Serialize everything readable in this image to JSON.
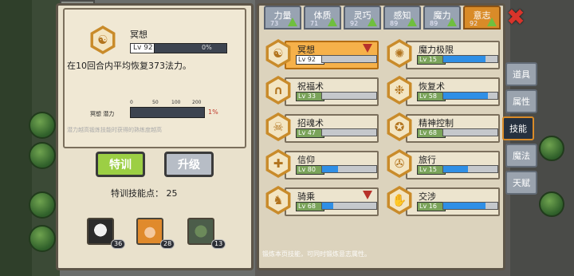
{
  "skill_detail": {
    "name": "冥想",
    "level": "Lv 92",
    "progress_text": "0%",
    "progress": 0,
    "description": "在10回合内平均恢复373法力。",
    "potential_label": "冥想 潜力",
    "potential_ticks": [
      "0",
      "50",
      "100",
      "200"
    ],
    "potential_percent": "1%",
    "note": "潜力越高锻炼技能时获得的熟练度越高"
  },
  "buttons": {
    "train": "特训",
    "upgrade": "升级"
  },
  "training_points": "特训技能点： 25",
  "companions": [
    {
      "icon": "panda-avatar",
      "count": "36"
    },
    {
      "icon": "girl-avatar",
      "count": "28"
    },
    {
      "icon": "orc-avatar",
      "count": "13"
    }
  ],
  "attributes": [
    {
      "name": "力量",
      "value": "73"
    },
    {
      "name": "体质",
      "value": "71"
    },
    {
      "name": "灵巧",
      "value": "92"
    },
    {
      "name": "感知",
      "value": "89"
    },
    {
      "name": "魔力",
      "value": "89"
    },
    {
      "name": "意志",
      "value": "92"
    }
  ],
  "skills": [
    {
      "name": "冥想",
      "level": "Lv 92",
      "progress": 0,
      "selected": true,
      "warn": true,
      "icon": "meditation-icon"
    },
    {
      "name": "魔力极限",
      "level": "Lv 15",
      "progress": 0.78,
      "icon": "mana-limit-icon"
    },
    {
      "name": "祝福术",
      "level": "Lv 33",
      "progress": 0.0,
      "icon": "blessing-icon"
    },
    {
      "name": "恢复术",
      "level": "Lv 58",
      "progress": 0.82,
      "icon": "restore-icon"
    },
    {
      "name": "招魂术",
      "level": "Lv 47",
      "progress": 0.0,
      "icon": "summon-icon"
    },
    {
      "name": "精神控制",
      "level": "Lv 68",
      "progress": 0.0,
      "icon": "mind-control-icon"
    },
    {
      "name": "信仰",
      "level": "Lv 80",
      "progress": 0.3,
      "icon": "faith-icon"
    },
    {
      "name": "旅行",
      "level": "Lv 15",
      "progress": 0.45,
      "icon": "travel-icon"
    },
    {
      "name": "骑乘",
      "level": "Lv 68",
      "progress": 0.2,
      "warn": true,
      "icon": "riding-icon"
    },
    {
      "name": "交涉",
      "level": "Lv 16",
      "progress": 0.78,
      "icon": "negotiation-icon"
    }
  ],
  "footer_hint": "锻炼本页技能，可同时锻炼意志属性。",
  "side_tabs": [
    {
      "label": "道具"
    },
    {
      "label": "属性"
    },
    {
      "label": "技能",
      "active": true
    },
    {
      "label": "魔法"
    },
    {
      "label": "天赋"
    }
  ],
  "colors": {
    "accent": "#d98b28",
    "bar": "#2f8fe6",
    "close": "#d9342b"
  }
}
